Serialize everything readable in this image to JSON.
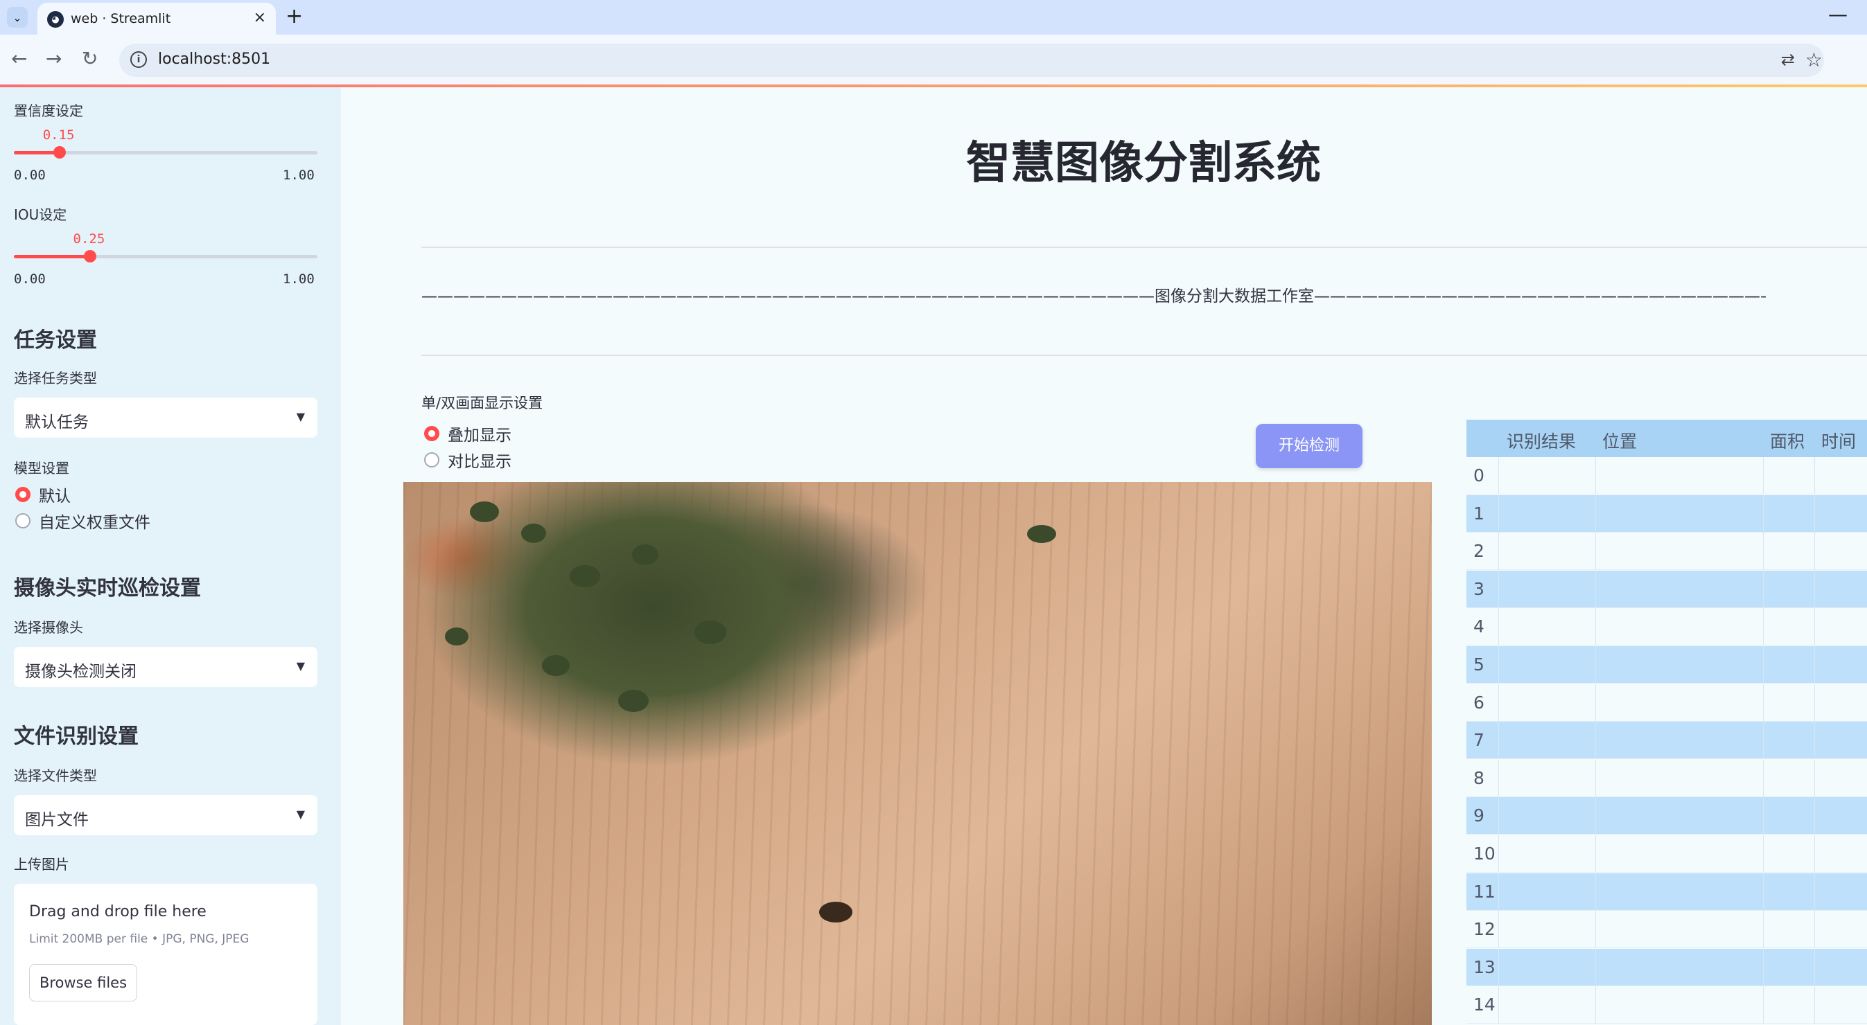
{
  "browser": {
    "tab_title": "web · Streamlit",
    "url": "localhost:8501",
    "new_tab": "+",
    "close": "×",
    "minimize": "—"
  },
  "sidebar": {
    "confidence": {
      "label": "置信度设定",
      "value": "0.15",
      "fraction": 0.15,
      "min": "0.00",
      "max": "1.00"
    },
    "iou": {
      "label": "IOU设定",
      "value": "0.25",
      "fraction": 0.25,
      "min": "0.00",
      "max": "1.00"
    },
    "task_section": {
      "heading": "任务设置",
      "select_label": "选择任务类型",
      "selected": "默认任务"
    },
    "model_section": {
      "label": "模型设置",
      "options": [
        "默认",
        "自定义权重文件"
      ],
      "selected_index": 0
    },
    "camera_section": {
      "heading": "摄像头实时巡检设置",
      "select_label": "选择摄像头",
      "selected": "摄像头检测关闭"
    },
    "file_section": {
      "heading": "文件识别设置",
      "select_label": "选择文件类型",
      "selected": "图片文件"
    },
    "upload": {
      "label": "上传图片",
      "drop_title": "Drag and drop file here",
      "limit": "Limit 200MB per file • JPG, PNG, JPEG",
      "browse": "Browse files"
    }
  },
  "main": {
    "title": "智慧图像分割系统",
    "studio_line": "——————————————————————————————————————————————图像分割大数据工作室——————————————————————————————————————————————",
    "display_label": "单/双画面显示设置",
    "display_options": [
      "叠加显示",
      "对比显示"
    ],
    "display_selected_index": 0,
    "start_button": "开始检测"
  },
  "results_table": {
    "columns": [
      "识别结果",
      "位置",
      "面积",
      "时间"
    ],
    "row_indices": [
      "0",
      "1",
      "2",
      "3",
      "4",
      "5",
      "6",
      "7",
      "8",
      "9",
      "10",
      "11",
      "12",
      "13",
      "14"
    ]
  },
  "colors": {
    "accent": "#ff4b4b",
    "button": "#8b95f5",
    "sidebar_bg": "#e4f2fa",
    "table_header": "#a9d3f5",
    "table_stripe": "#bfe0fb"
  }
}
